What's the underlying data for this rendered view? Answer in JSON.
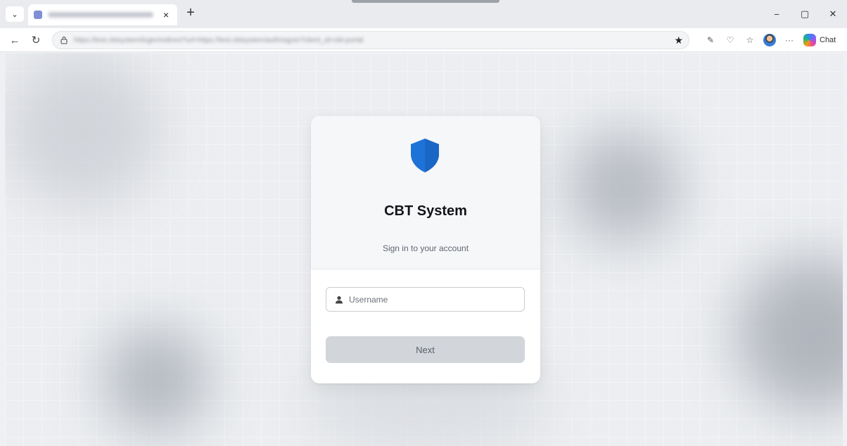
{
  "browser": {
    "tab_close_glyph": "×",
    "new_tab_glyph": "+",
    "chat_label": "Chat",
    "window_controls": {
      "minimize": "−",
      "maximize": "▢",
      "close": "✕"
    },
    "url_placeholder_blurred": "https://test.cbtsystem/login/redirect?url=https://test.cbtsystem/auth/signin?client_id=cbt-portal"
  },
  "login": {
    "title": "CBT System",
    "subtitle": "Sign in to your account",
    "username_placeholder": "Username",
    "next_label": "Next"
  },
  "colors": {
    "accent": "#1e73d8",
    "card_header_bg": "#f6f7f9",
    "button_disabled_bg": "#d2d5da"
  }
}
